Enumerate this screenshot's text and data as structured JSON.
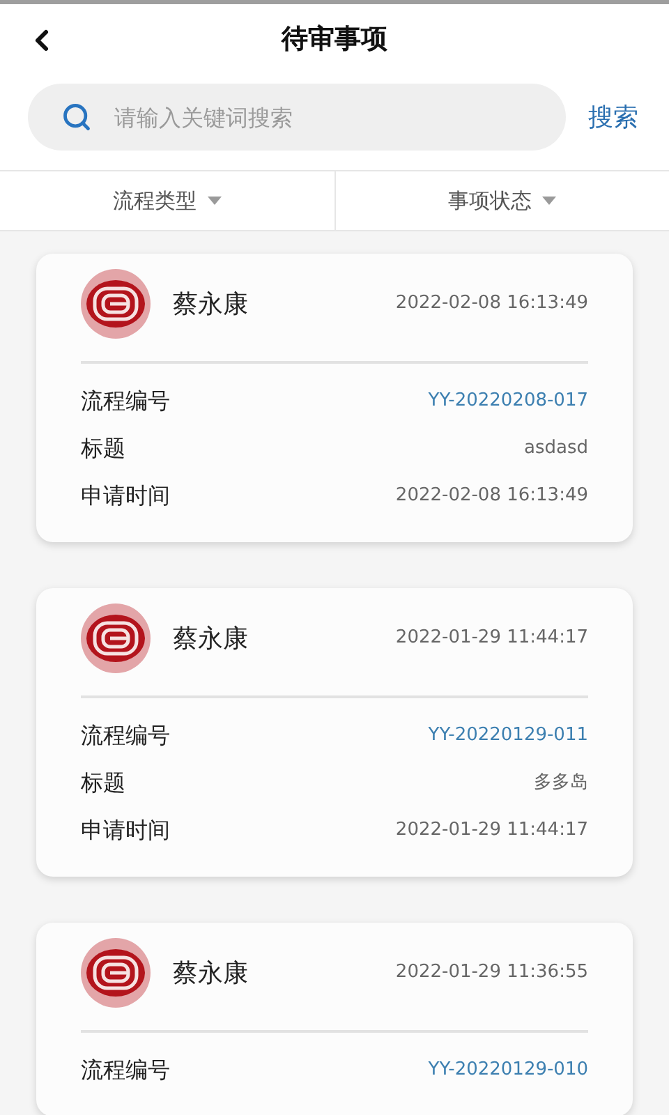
{
  "header": {
    "title": "待审事项"
  },
  "search": {
    "placeholder": "请输入关键词搜索",
    "button": "搜索"
  },
  "filters": [
    {
      "label": "流程类型"
    },
    {
      "label": "事项状态"
    }
  ],
  "cards": [
    {
      "name": "蔡永康",
      "time": "2022-02-08 16:13:49",
      "fields": [
        {
          "label": "流程编号",
          "value": "YY-20220208-017",
          "kind": "link"
        },
        {
          "label": "标题",
          "value": "asdasd",
          "kind": "plain"
        },
        {
          "label": "申请时间",
          "value": "2022-02-08 16:13:49",
          "kind": "plain"
        }
      ]
    },
    {
      "name": "蔡永康",
      "time": "2022-01-29 11:44:17",
      "fields": [
        {
          "label": "流程编号",
          "value": "YY-20220129-011",
          "kind": "link"
        },
        {
          "label": "标题",
          "value": "多多岛",
          "kind": "plain"
        },
        {
          "label": "申请时间",
          "value": "2022-01-29 11:44:17",
          "kind": "plain"
        }
      ]
    },
    {
      "name": "蔡永康",
      "time": "2022-01-29 11:36:55",
      "fields": [
        {
          "label": "流程编号",
          "value": "YY-20220129-010",
          "kind": "link"
        }
      ]
    }
  ]
}
